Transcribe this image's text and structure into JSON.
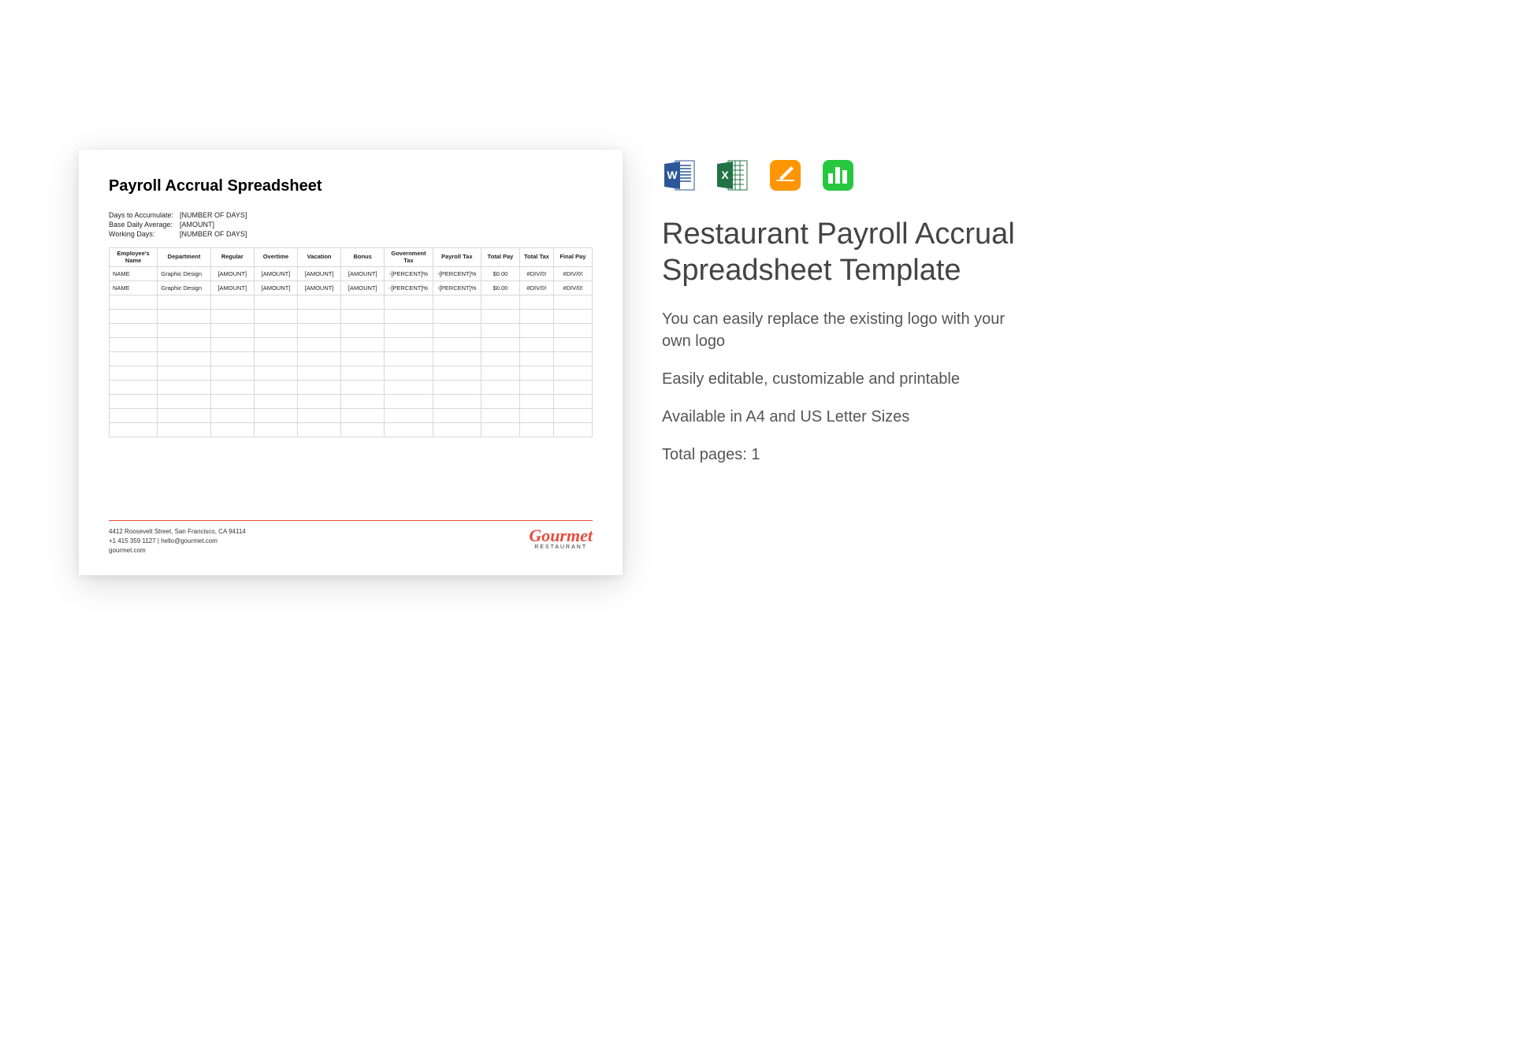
{
  "preview": {
    "title": "Payroll Accrual Spreadsheet",
    "meta": {
      "days_label": "Days to Accumulate:",
      "days_value": "[NUMBER OF DAYS]",
      "base_label": "Base Daily Average:",
      "base_value": "[AMOUNT]",
      "working_label": "Working Days:",
      "working_value": "[NUMBER OF DAYS]"
    },
    "headers": {
      "employee": "Employee's Name",
      "department": "Department",
      "regular": "Regular",
      "overtime": "Overtime",
      "vacation": "Vacation",
      "bonus": "Bonus",
      "govtax": "Government Tax",
      "payrolltax": "Payroll Tax",
      "totalpay": "Total Pay",
      "totaltax": "Total Tax",
      "finalpay": "Final Pay"
    },
    "rows": [
      {
        "name": "NAME",
        "dept": "Graphic Design",
        "regular": "[AMOUNT]",
        "overtime": "[AMOUNT]",
        "vacation": "[AMOUNT]",
        "bonus": "[AMOUNT]",
        "govtax": "-[PERCENT]%",
        "payrolltax": "-[PERCENT]%",
        "totalpay": "$0.00",
        "totaltax": "#DIV/0!",
        "finalpay": "#DIV/0!"
      },
      {
        "name": "NAME",
        "dept": "Graphic Design",
        "regular": "[AMOUNT]",
        "overtime": "[AMOUNT]",
        "vacation": "[AMOUNT]",
        "bonus": "[AMOUNT]",
        "govtax": "-[PERCENT]%",
        "payrolltax": "-[PERCENT]%",
        "totalpay": "$0.00",
        "totaltax": "#DIV/0!",
        "finalpay": "#DIV/0!"
      }
    ],
    "footer": {
      "address": "4412 Roosevelt Street, San Francisco, CA 94114",
      "contact": "+1 415 359 1127 | hello@gourmet.com",
      "website": "gourmet.com",
      "brand_name": "Gourmet",
      "brand_sub": "RESTAURANT"
    }
  },
  "info": {
    "title": "Restaurant Payroll Accrual Spreadsheet Template",
    "desc1": "You can easily replace the existing logo with your own logo",
    "desc2": "Easily editable, customizable and printable",
    "desc3": "Available in A4 and US Letter Sizes",
    "desc4": "Total pages: 1"
  }
}
